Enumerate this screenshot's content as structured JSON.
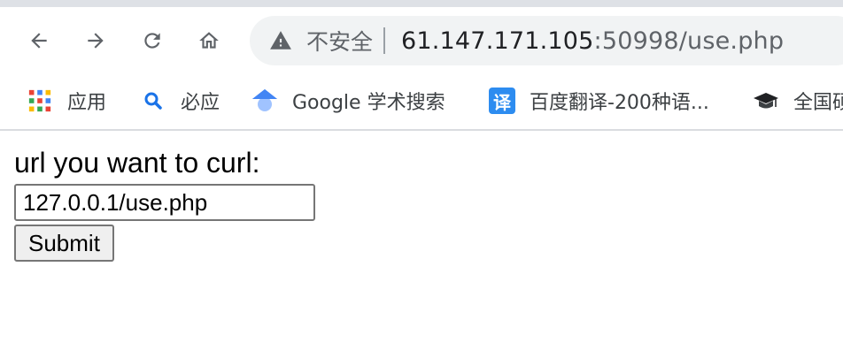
{
  "browser": {
    "security_label": "不安全",
    "url_host": "61.147.171.105",
    "url_rest": ":50998/use.php",
    "icons": {
      "back": "back-arrow-icon",
      "forward": "forward-arrow-icon",
      "reload": "reload-icon",
      "home": "home-icon",
      "warning": "warning-triangle-icon"
    }
  },
  "bookmarks": [
    {
      "label": "应用",
      "icon": "apps-grid-icon"
    },
    {
      "label": "必应",
      "icon": "search-icon"
    },
    {
      "label": "Google 学术搜索",
      "icon": "scholar-icon"
    },
    {
      "label": "百度翻译-200种语...",
      "icon": "translate-icon",
      "icon_text": "译"
    },
    {
      "label": "全国硕",
      "icon": "graduation-cap-icon"
    }
  ],
  "page": {
    "label": "url you want to curl:",
    "input_value": "127.0.0.1/use.php",
    "submit_label": "Submit"
  }
}
